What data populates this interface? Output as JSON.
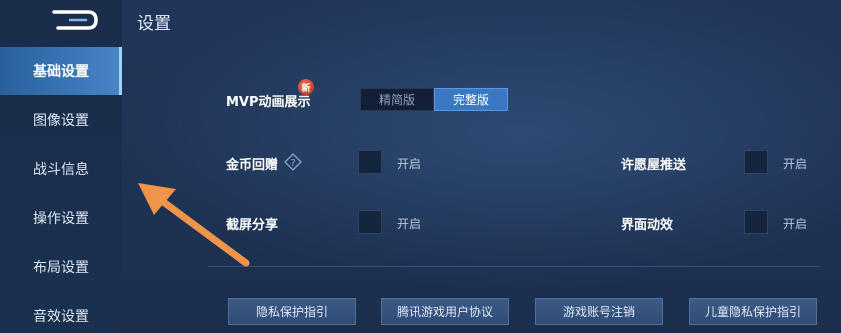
{
  "header": {
    "title": "设置"
  },
  "sidebar": {
    "items": [
      {
        "label": "基础设置",
        "active": true
      },
      {
        "label": "图像设置",
        "active": false
      },
      {
        "label": "战斗信息",
        "active": false
      },
      {
        "label": "操作设置",
        "active": false
      },
      {
        "label": "布局设置",
        "active": false
      },
      {
        "label": "音效设置",
        "active": false
      }
    ]
  },
  "settings": {
    "mvp": {
      "label": "MVP动画展示",
      "badge": "新",
      "options": [
        "精简版",
        "完整版"
      ],
      "selected": "完整版"
    },
    "coin_gift": {
      "label": "金币回赠",
      "help_icon": "question-icon",
      "toggle_text": "开启",
      "checked": false
    },
    "wish_push": {
      "label": "许愿屋推送",
      "toggle_text": "开启",
      "checked": false
    },
    "screenshot_share": {
      "label": "截屏分享",
      "toggle_text": "开启",
      "checked": false
    },
    "ui_effects": {
      "label": "界面动效",
      "toggle_text": "开启",
      "checked": false
    }
  },
  "footer_links": [
    "隐私保护指引",
    "腾讯游戏用户协议",
    "游戏账号注销",
    "儿童隐私保护指引"
  ],
  "annotation": {
    "icon": "arrow-pointer-icon",
    "color": "#f0944a"
  },
  "colors": {
    "accent": "#3a78c4",
    "background": "#1e3354",
    "sidebar_active": "#3b77b8"
  }
}
